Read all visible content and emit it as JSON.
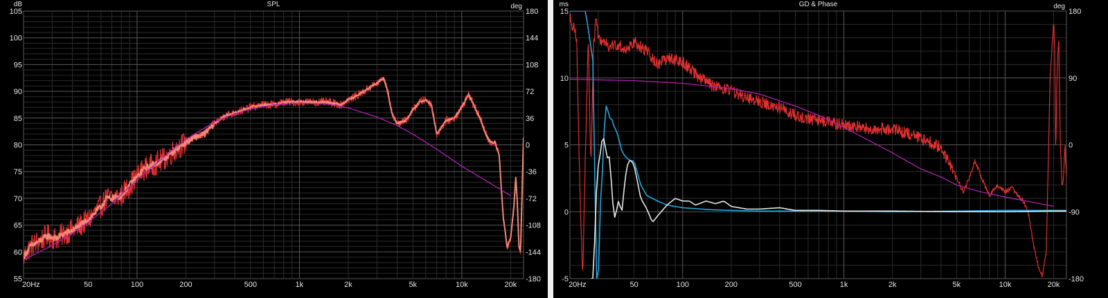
{
  "colors": {
    "background": "#000000",
    "window": "#f0f0f0",
    "grid_major": "#5a5a5a",
    "grid_minor": "#2c2c2c",
    "text": "#e8e8e8",
    "measured_red": "#e03030",
    "smoothed_red": "#f08070",
    "target_purple": "#b020b0",
    "gd_blue": "#20a8e0",
    "gd_white": "#e8e8e8"
  },
  "chart_data": [
    {
      "type": "line",
      "title": "SPL",
      "ylabel": "dB",
      "y2label": "deg",
      "xscale": "log",
      "xlim": [
        20,
        24000
      ],
      "ylim": [
        55,
        105
      ],
      "y2lim": [
        -180,
        180
      ],
      "grid": true,
      "xticks": [
        "20Hz",
        "50",
        "100",
        "200",
        "500",
        "1k",
        "2k",
        "5k",
        "10k",
        "20k"
      ],
      "yticks": [
        "55",
        "60",
        "65",
        "70",
        "75",
        "80",
        "85",
        "90",
        "95",
        "100",
        "105"
      ],
      "y2ticks": [
        "-180",
        "-144",
        "-108",
        "-72",
        "-36",
        "0",
        "36",
        "72",
        "108",
        "144",
        "180"
      ],
      "series": [
        {
          "key": "spl_measured",
          "color": "#e03030",
          "width": 1.2,
          "noise": 2.2,
          "noise_cut": 200,
          "x": [
            20,
            22,
            25,
            28,
            32,
            36,
            40,
            45,
            50,
            56,
            60,
            65,
            70,
            80,
            90,
            100,
            110,
            120,
            130,
            150,
            170,
            190,
            200,
            230,
            260,
            300,
            350,
            400,
            450,
            500,
            600,
            700,
            800,
            900,
            1000,
            1200,
            1500,
            1800,
            2000,
            2200,
            2500,
            2800,
            3000,
            3300,
            3500,
            3700,
            4000,
            4500,
            5000,
            5500,
            6000,
            6500,
            7000,
            8000,
            9000,
            10000,
            11000,
            12000,
            13000,
            14000,
            15000,
            16000,
            17000,
            18000,
            19000,
            20000,
            21000,
            21500,
            22000,
            22500,
            23000,
            24000
          ],
          "y": [
            59,
            61,
            62,
            63,
            62.5,
            63.5,
            64,
            65,
            66,
            67.5,
            68.5,
            70,
            70,
            70.5,
            72.5,
            74,
            75.5,
            76,
            76.5,
            77.5,
            79,
            80,
            80.5,
            81.5,
            82,
            84,
            85.5,
            86,
            86.5,
            87,
            87.5,
            87.5,
            88,
            88,
            88,
            88,
            88,
            87.5,
            88.5,
            89,
            90,
            91,
            91.5,
            92.5,
            90,
            86,
            84,
            84.5,
            86.5,
            88,
            88.5,
            87.5,
            82,
            84.5,
            85,
            87,
            89.5,
            87,
            85,
            82,
            80.5,
            80.5,
            78,
            66.5,
            61,
            62.5,
            69,
            74,
            69,
            61,
            60,
            81.5
          ]
        },
        {
          "key": "spl_smoothed",
          "color": "#f08878",
          "width": 2.0,
          "noise": 0.6,
          "noise_cut": 300,
          "x": [
            20,
            22,
            25,
            28,
            32,
            36,
            40,
            45,
            50,
            56,
            60,
            65,
            70,
            80,
            90,
            100,
            110,
            120,
            130,
            150,
            170,
            190,
            200,
            230,
            260,
            300,
            350,
            400,
            450,
            500,
            600,
            700,
            800,
            900,
            1000,
            1200,
            1500,
            1800,
            2000,
            2200,
            2500,
            2800,
            3000,
            3300,
            3500,
            3700,
            4000,
            4500,
            5000,
            5500,
            6000,
            6500,
            7000,
            8000,
            9000,
            10000,
            11000,
            12000,
            13000,
            14000,
            15000,
            16000,
            17000,
            18000,
            19000,
            20000,
            21000,
            21500,
            22000,
            22500,
            23000,
            24000
          ],
          "y": [
            59,
            61,
            62,
            63,
            62.5,
            63.5,
            64,
            65,
            66,
            67.5,
            68.5,
            70,
            70,
            70.5,
            72.5,
            74,
            75.5,
            76,
            76.5,
            77.5,
            79,
            80,
            80.5,
            81.5,
            82,
            84,
            85.5,
            86,
            86.5,
            87,
            87.5,
            87.5,
            88,
            88,
            88,
            88,
            88,
            87.5,
            88.5,
            89,
            90,
            91,
            91.5,
            92.5,
            90,
            86,
            84,
            84.5,
            86.5,
            88,
            88.5,
            87.5,
            82,
            84.5,
            85,
            87,
            89.5,
            87,
            85,
            82,
            80.5,
            80.5,
            78,
            66.5,
            61,
            62.5,
            69,
            74,
            69,
            61,
            60,
            81.5
          ]
        },
        {
          "key": "spl_target",
          "color": "#b020b0",
          "width": 1.3,
          "noise": 0,
          "x": [
            20,
            30,
            40,
            50,
            70,
            100,
            150,
            200,
            300,
            400,
            500,
            700,
            1000,
            1500,
            2000,
            3000,
            4000,
            5000,
            7000,
            10000,
            15000,
            20000
          ],
          "y": [
            58.5,
            61.2,
            63.5,
            65.5,
            69,
            73.5,
            78,
            81,
            84.3,
            85.8,
            86.7,
            87.5,
            87.8,
            87.6,
            86.9,
            85.2,
            83.6,
            82,
            79.2,
            76,
            72.8,
            70.5
          ]
        }
      ]
    },
    {
      "type": "line",
      "title": "GD & Phase",
      "ylabel": "ms",
      "y2label": "deg",
      "xscale": "log",
      "xlim": [
        20,
        24000
      ],
      "ylim": [
        -5,
        15
      ],
      "y2lim": [
        -180,
        180
      ],
      "grid": true,
      "xticks": [
        "20Hz",
        "50",
        "100",
        "200",
        "500",
        "1k",
        "2k",
        "5k",
        "10k",
        "20k"
      ],
      "yticks": [
        "-5",
        "0",
        "5",
        "10",
        "15"
      ],
      "y2ticks": [
        "-180",
        "-90",
        "0",
        "90",
        "180"
      ],
      "series": [
        {
          "key": "phase_measured",
          "color": "#e03030",
          "width": 1.2,
          "noise": 0.45,
          "noise_cut": 5000,
          "x": [
            20,
            22,
            23,
            24,
            25,
            26,
            27,
            28,
            29,
            30,
            32,
            35,
            40,
            45,
            50,
            60,
            70,
            80,
            100,
            120,
            150,
            200,
            250,
            300,
            400,
            500,
            700,
            1000,
            1500,
            2000,
            3000,
            4000,
            5000,
            5500,
            6000,
            6500,
            7000,
            8000,
            9000,
            10000,
            11000,
            12000,
            13000,
            14000,
            15000,
            16000,
            17000,
            18000,
            19000,
            20000,
            20300,
            20600,
            21000,
            21500,
            22000,
            22500,
            23000,
            23500,
            24000
          ],
          "y": [
            14.5,
            13,
            2,
            -4.8,
            5,
            13,
            3,
            12.5,
            14.5,
            13,
            12.7,
            12.3,
            12.5,
            12,
            12.7,
            12,
            11,
            11.5,
            11.2,
            10.3,
            9.5,
            9,
            8.5,
            8.2,
            7.8,
            7.2,
            6.8,
            6.5,
            6.2,
            6.2,
            5.5,
            4.8,
            2.5,
            1.5,
            2.5,
            3.8,
            2.8,
            1.2,
            2,
            1.5,
            1.8,
            1.2,
            0.8,
            -0.2,
            -2.5,
            -4,
            -4.8,
            -3,
            10,
            14.2,
            12,
            4,
            10.5,
            13,
            5,
            2,
            2.5,
            5,
            2.5
          ]
        },
        {
          "key": "phase_target",
          "color": "#b020b0",
          "width": 1.3,
          "noise": 0,
          "x": [
            20,
            50,
            100,
            200,
            300,
            500,
            700,
            1000,
            1500,
            2000,
            3000,
            4000,
            5000,
            7000,
            10000,
            15000,
            20000
          ],
          "y": [
            9.9,
            9.8,
            9.6,
            9.2,
            8.8,
            7.9,
            7.2,
            6.3,
            5.2,
            4.4,
            3.2,
            2.6,
            2,
            1.5,
            1.1,
            0.7,
            0.4
          ]
        },
        {
          "key": "gd_blue",
          "color": "#20a8e0",
          "width": 1.6,
          "noise": 0,
          "x": [
            20,
            25,
            28,
            29,
            30,
            31,
            32,
            33,
            34,
            35,
            36,
            37,
            38,
            40,
            42,
            45,
            48,
            50,
            55,
            60,
            70,
            80,
            100,
            150,
            200,
            300,
            500,
            1000,
            2000,
            5000,
            10000,
            20000,
            24000
          ],
          "y": [
            15,
            15,
            11,
            -5,
            -5,
            1,
            3.5,
            7.5,
            8.2,
            6.8,
            7.2,
            6.5,
            6.3,
            5.6,
            4.5,
            4,
            3.8,
            3.8,
            2,
            1.2,
            0.8,
            0.5,
            0.3,
            0.15,
            0.1,
            0.05,
            0.05,
            0.05,
            0,
            0.05,
            0.1,
            0.1,
            0.1
          ]
        },
        {
          "key": "gd_white",
          "color": "#e8e8e8",
          "width": 1.6,
          "noise": 0,
          "x": [
            27,
            28,
            29,
            30,
            31,
            32,
            33,
            34,
            35,
            36,
            37,
            38,
            40,
            42,
            44,
            46,
            48,
            50,
            55,
            60,
            65,
            70,
            80,
            90,
            100,
            110,
            120,
            140,
            160,
            180,
            200,
            250,
            300,
            400,
            500,
            700,
            1000,
            2000,
            5000,
            10000,
            20000,
            24000
          ],
          "y": [
            -5,
            -5,
            1,
            3.5,
            4.5,
            5.8,
            5,
            4,
            4.2,
            2.5,
            0.5,
            -0.5,
            0.8,
            0,
            2.5,
            3.8,
            3.8,
            3.5,
            1,
            0.2,
            -0.8,
            -0.3,
            0.5,
            1,
            0.8,
            0.8,
            0.5,
            0.8,
            0.6,
            0.8,
            0.4,
            0.2,
            0.2,
            0.3,
            0.1,
            0.1,
            0.05,
            0.05,
            0,
            0,
            0.05,
            0.05
          ]
        }
      ]
    }
  ]
}
